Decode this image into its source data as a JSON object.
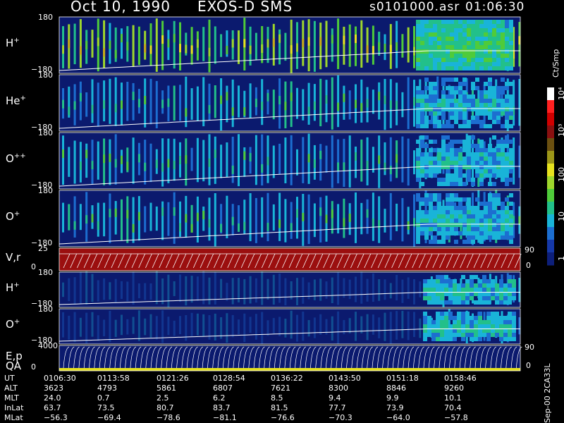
{
  "title": {
    "date": "Oct 10, 1990",
    "instrument": "EXOS-D SMS",
    "file": "s0101000.asr",
    "time": "01:06:30"
  },
  "colorbar": {
    "unit": "Ct/Smp",
    "labels": [
      "10⁴",
      "10³",
      "100",
      "10",
      "1"
    ]
  },
  "panels": [
    {
      "label": "H",
      "sup": "+",
      "ymax": "180",
      "ymin": "−180",
      "kind": "spectro",
      "palette": "H+top"
    },
    {
      "label": "He",
      "sup": "+",
      "ymax": "180",
      "ymin": "−180",
      "kind": "spectro",
      "palette": "He"
    },
    {
      "label": "O",
      "sup": "++",
      "ymax": "180",
      "ymin": "−180",
      "kind": "spectro",
      "palette": "O++"
    },
    {
      "label": "O",
      "sup": "+",
      "ymax": "180",
      "ymin": "−180",
      "kind": "spectro",
      "palette": "O+"
    },
    {
      "label": "V,r",
      "sup": "",
      "ymax": "25",
      "ymin": "0",
      "right": "90",
      "right0": "0",
      "kind": "vr"
    },
    {
      "label": "H",
      "sup": "+",
      "ymax": "180",
      "ymin": "−180",
      "kind": "spectro",
      "palette": "H+low"
    },
    {
      "label": "O",
      "sup": "+",
      "ymax": "180",
      "ymin": "−180",
      "kind": "spectro",
      "palette": "O+low"
    },
    {
      "label": "E,p",
      "label2": "QA",
      "sup": "",
      "ymax": "4000",
      "ymin": "0",
      "right": "90",
      "right0": "0",
      "kind": "ep"
    }
  ],
  "footer": {
    "rows": [
      {
        "name": "UT",
        "values": [
          "0106:30",
          "0113:58",
          "0121:26",
          "0128:54",
          "0136:22",
          "0143:50",
          "0151:18",
          "0158:46"
        ]
      },
      {
        "name": "ALT",
        "values": [
          "3623",
          "4793",
          "5861",
          "6807",
          "7621",
          "8300",
          "8846",
          "9260"
        ]
      },
      {
        "name": "MLT",
        "values": [
          "24.0",
          "0.7",
          "2.5",
          "6.2",
          "8.5",
          "9.4",
          "9.9",
          "10.1"
        ]
      },
      {
        "name": "InLat",
        "values": [
          "63.7",
          "73.5",
          "80.7",
          "83.7",
          "81.5",
          "77.7",
          "73.9",
          "70.4"
        ]
      },
      {
        "name": "MLat",
        "values": [
          "−56.3",
          "−69.4",
          "−78.6",
          "−81.1",
          "−76.6",
          "−70.3",
          "−64.0",
          "−57.8"
        ]
      }
    ],
    "side_text": "Sep-00  2CA33L"
  },
  "chart_data": {
    "type": "heatmap",
    "title": "Oct 10, 1990   EXOS-D SMS",
    "x_ticks": [
      "0106:30",
      "0113:58",
      "0121:26",
      "0128:54",
      "0136:22",
      "0143:50",
      "0151:18",
      "0158:46"
    ],
    "color_scale": {
      "unit": "Ct/Smp",
      "log": true,
      "range": [
        1,
        10000
      ]
    },
    "series": [
      {
        "name": "H+",
        "y_range": [
          -180,
          180
        ]
      },
      {
        "name": "He+",
        "y_range": [
          -180,
          180
        ]
      },
      {
        "name": "O++",
        "y_range": [
          -180,
          180
        ]
      },
      {
        "name": "O+",
        "y_range": [
          -180,
          180
        ]
      },
      {
        "name": "V,r",
        "y_range": [
          0,
          25
        ],
        "y2_range": [
          0,
          90
        ]
      },
      {
        "name": "H+",
        "y_range": [
          -180,
          180
        ]
      },
      {
        "name": "O+",
        "y_range": [
          -180,
          180
        ]
      },
      {
        "name": "E,p QA",
        "y_range": [
          0,
          4000
        ],
        "y2_range": [
          0,
          90
        ]
      }
    ]
  }
}
